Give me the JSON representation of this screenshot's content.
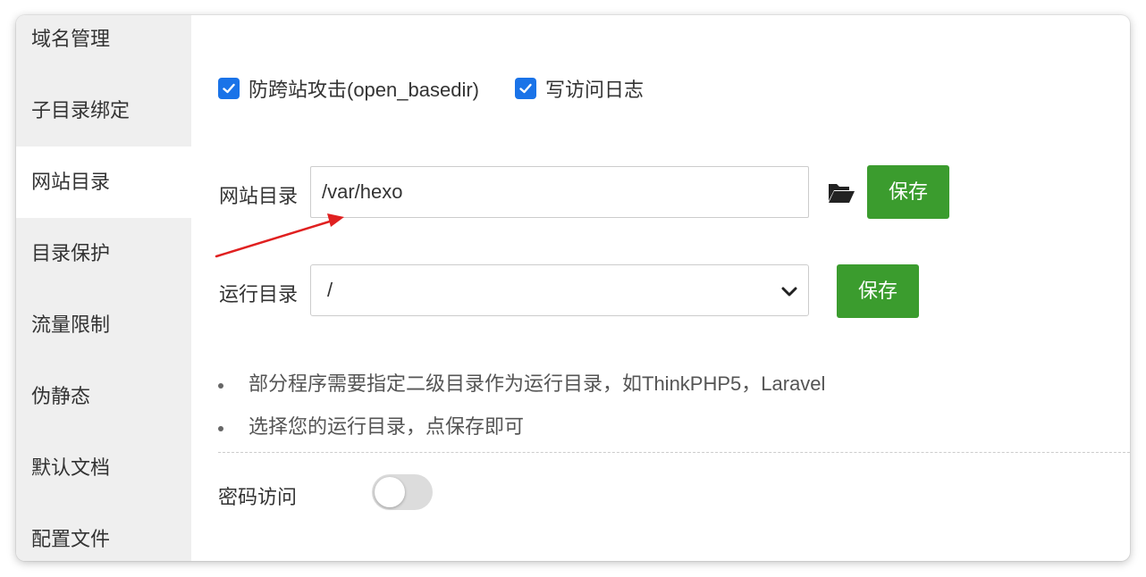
{
  "sidebar": {
    "items": [
      {
        "label": "域名管理"
      },
      {
        "label": "子目录绑定"
      },
      {
        "label": "网站目录"
      },
      {
        "label": "目录保护"
      },
      {
        "label": "流量限制"
      },
      {
        "label": "伪静态"
      },
      {
        "label": "默认文档"
      },
      {
        "label": "配置文件"
      }
    ],
    "active_index": 2
  },
  "options": {
    "anti_xss": {
      "label": "防跨站攻击(open_basedir)",
      "checked": true
    },
    "access_log": {
      "label": "写访问日志",
      "checked": true
    }
  },
  "site_dir": {
    "label": "网站目录",
    "value": "/var/hexo",
    "save_label": "保存"
  },
  "run_dir": {
    "label": "运行目录",
    "value": "/",
    "save_label": "保存"
  },
  "hints": [
    "部分程序需要指定二级目录作为运行目录，如ThinkPHP5，Laravel",
    "选择您的运行目录，点保存即可"
  ],
  "password_access": {
    "label": "密码访问",
    "enabled": false
  },
  "icons": {
    "checkbox": "check-icon",
    "folder": "folder-open-icon",
    "select": "chevron-down-icon",
    "annotation": "red-arrow"
  },
  "colors": {
    "accent_blue": "#1a73e8",
    "save_green": "#3b9c2e",
    "sidebar_bg": "#efefef",
    "annotation_red": "#e02020"
  }
}
